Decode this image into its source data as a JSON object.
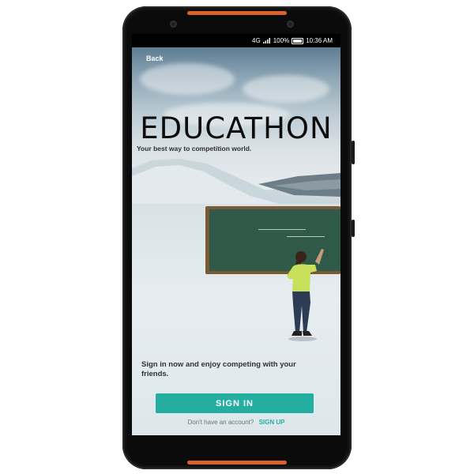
{
  "status_bar": {
    "network": "4G",
    "signal_icon": "signal-bars-icon",
    "battery_percent": "100%",
    "battery_icon": "battery-icon",
    "time": "10:36 AM"
  },
  "header": {
    "back_label": "Back"
  },
  "hero": {
    "title": "EDUCATHON",
    "tagline": "Your best way to competition world."
  },
  "body": {
    "promo_text": "Sign in now and enjoy competing with your friends."
  },
  "actions": {
    "signin_label": "SIGN IN",
    "account_prompt": "Don't have an account?",
    "signup_label": "SIGN UP"
  },
  "colors": {
    "accent": "#23aea0",
    "frame_accent": "#d9622b"
  }
}
